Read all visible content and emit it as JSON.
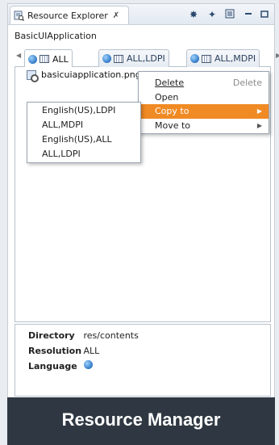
{
  "view": {
    "title": "Resource Explorer",
    "close_glyph": "✗",
    "toolbar_icons": [
      "gear-icon",
      "pin-icon",
      "menu-icon",
      "minimize-icon",
      "maximize-icon"
    ]
  },
  "project": {
    "name": "BasicUIApplication"
  },
  "sub_tabs": [
    {
      "label": "ALL",
      "active": true
    },
    {
      "label": "ALL,LDPI",
      "active": false
    },
    {
      "label": "ALL,MDPI",
      "active": false
    }
  ],
  "files": [
    {
      "name": "basicuiapplication.png"
    }
  ],
  "context_menu": {
    "items": [
      {
        "label": "Delete",
        "accelerator": "Delete",
        "submenu": false,
        "highlighted": false
      },
      {
        "label": "Open",
        "accelerator": "",
        "submenu": false,
        "highlighted": false
      },
      {
        "label": "Copy to",
        "accelerator": "",
        "submenu": true,
        "highlighted": true
      },
      {
        "label": "Move to",
        "accelerator": "",
        "submenu": true,
        "highlighted": false
      }
    ],
    "highlight_color": "#f08a24"
  },
  "copy_to_submenu": {
    "items": [
      "English(US),LDPI",
      "ALL,MDPI",
      "English(US),ALL",
      "ALL,LDPI"
    ]
  },
  "properties": [
    {
      "key": "Directory",
      "value": "res/contents"
    },
    {
      "key": "Resolution",
      "value": "ALL"
    },
    {
      "key": "Language",
      "value": ""
    }
  ],
  "banner": {
    "text": "Resource Manager",
    "background": "#2f3842"
  }
}
